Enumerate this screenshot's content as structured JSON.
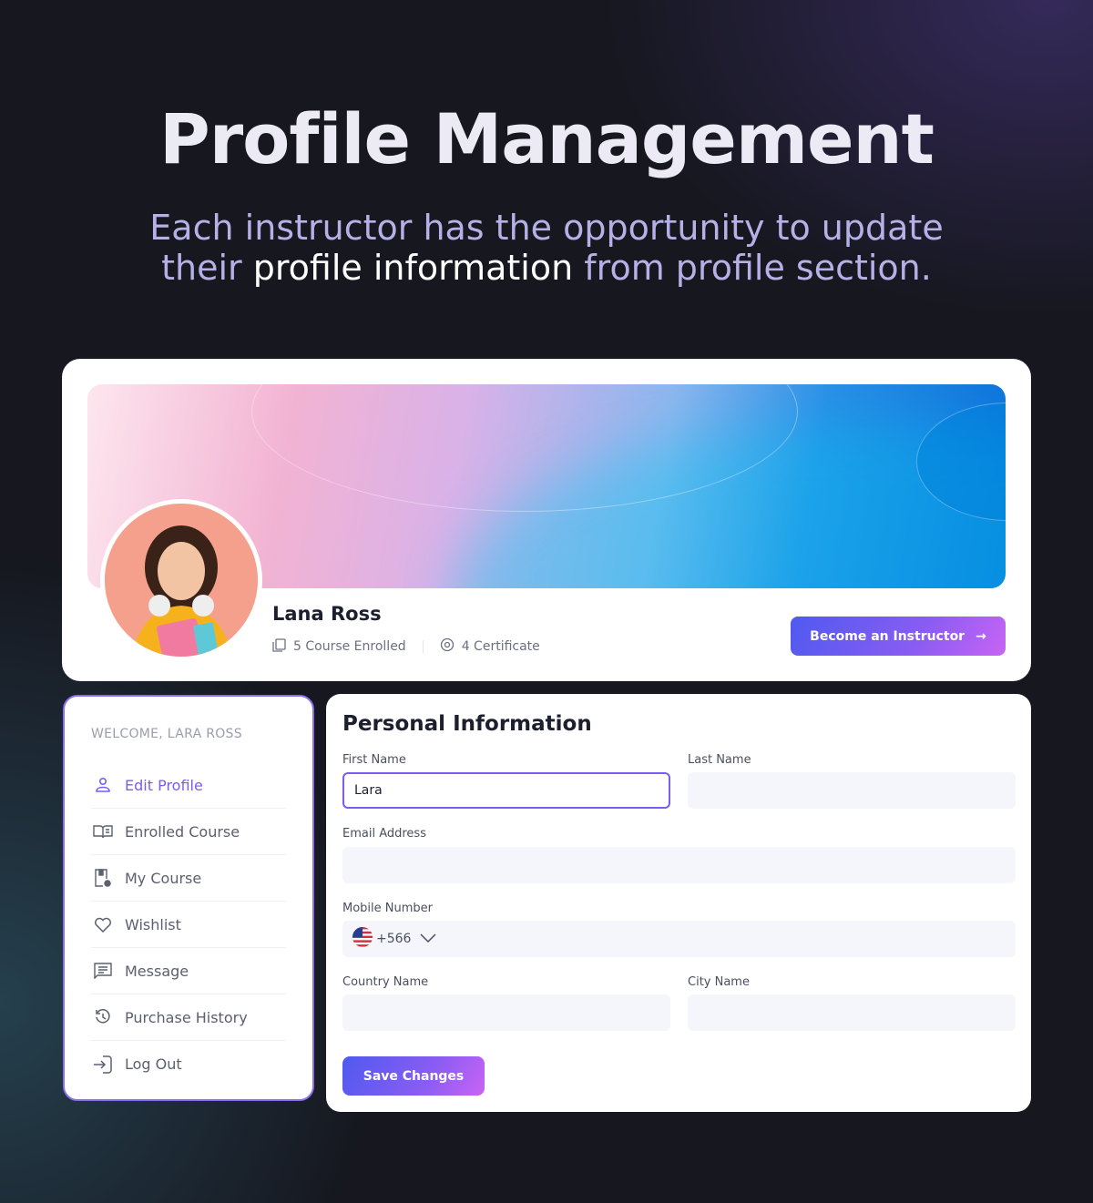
{
  "hero": {
    "title": "Profile Management",
    "subtitle_line1": "Each instructor has the opportunity to update",
    "subtitle_pre": "their ",
    "subtitle_highlight": "profile information",
    "subtitle_post": " from profile section."
  },
  "profile": {
    "name": "Lana Ross",
    "courses_enrolled": "5 Course Enrolled",
    "certificates": "4 Certificate",
    "cta": "Become an Instructor",
    "cta_icon": "arrow-right-icon"
  },
  "sidebar": {
    "welcome": "WELCOME, LARA ROSS",
    "items": [
      {
        "label": "Edit Profile",
        "icon": "user-icon",
        "active": true
      },
      {
        "label": "Enrolled Course",
        "icon": "book-open-icon"
      },
      {
        "label": "My Course",
        "icon": "course-icon"
      },
      {
        "label": "Wishlist",
        "icon": "heart-icon"
      },
      {
        "label": "Message",
        "icon": "message-icon"
      },
      {
        "label": "Purchase History",
        "icon": "history-icon"
      },
      {
        "label": "Log Out",
        "icon": "logout-icon"
      }
    ]
  },
  "form": {
    "title": "Personal Information",
    "first_name": {
      "label": "First Name",
      "value": "Lara"
    },
    "last_name": {
      "label": "Last Name",
      "value": ""
    },
    "email": {
      "label": "Email Address",
      "value": ""
    },
    "mobile": {
      "label": "Mobile Number",
      "country_code": "+566",
      "flag": "us-flag-icon",
      "value": ""
    },
    "country": {
      "label": "Country Name",
      "value": ""
    },
    "city": {
      "label": "City Name",
      "value": ""
    },
    "save": "Save Changes"
  },
  "colors": {
    "accent": "#7a5cf2",
    "button_start": "#4f5af0",
    "button_end": "#c864f4"
  }
}
